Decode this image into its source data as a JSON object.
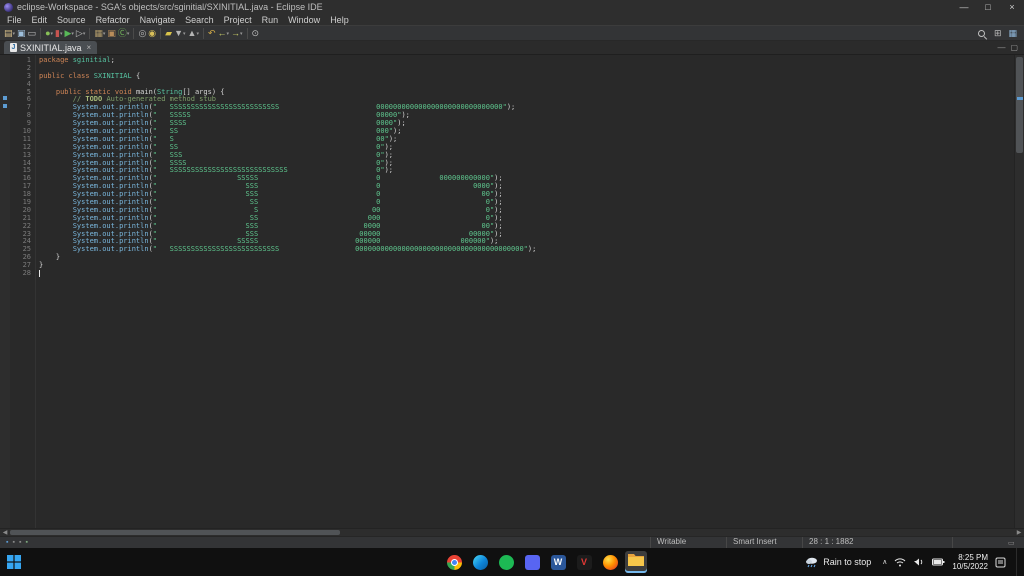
{
  "window": {
    "title": "eclipse-Workspace - SGA's objects/src/sginitial/SXINITIAL.java - Eclipse IDE",
    "controls": {
      "minimize": "—",
      "maximize": "□",
      "close": "×"
    }
  },
  "menubar": {
    "items": [
      "File",
      "Edit",
      "Source",
      "Refactor",
      "Navigate",
      "Search",
      "Project",
      "Run",
      "Window",
      "Help"
    ]
  },
  "toolbar": {
    "caret_glyph": "▾",
    "left": [
      {
        "name": "new-wizard",
        "glyph": "▤",
        "color": "#d8c08a",
        "caret": true
      },
      {
        "name": "save",
        "glyph": "▣",
        "color": "#9fc0dc"
      },
      {
        "name": "print",
        "glyph": "▭",
        "color": "#c0c0c0"
      },
      {
        "sep": true
      },
      {
        "name": "debug",
        "glyph": "●",
        "color": "#88c057",
        "caret": true
      },
      {
        "name": "coverage",
        "glyph": "▮",
        "color": "#c75450",
        "caret": true
      },
      {
        "name": "run",
        "glyph": "▶",
        "color": "#58b858",
        "caret": true
      },
      {
        "name": "external-tools",
        "glyph": "▷",
        "color": "#bdbdbd",
        "caret": true
      },
      {
        "sep": true
      },
      {
        "name": "new-java-project",
        "glyph": "▦",
        "color": "#b09a6a",
        "caret": true
      },
      {
        "name": "new-package",
        "glyph": "▣",
        "color": "#ba8d5a"
      },
      {
        "name": "new-class",
        "glyph": "Ⓒ",
        "color": "#74b85c",
        "caret": true
      },
      {
        "sep": true
      },
      {
        "name": "open-type",
        "glyph": "◎",
        "color": "#b8b8b8"
      },
      {
        "name": "search",
        "glyph": "◉",
        "color": "#d9c05a"
      },
      {
        "sep": true
      },
      {
        "name": "mark-occurrences",
        "glyph": "▰",
        "color": "#d9c34a"
      },
      {
        "name": "next-annotation",
        "glyph": "▼",
        "color": "#b5b5b5",
        "caret": true
      },
      {
        "name": "previous-annotation",
        "glyph": "▲",
        "color": "#b5b5b5",
        "caret": true
      },
      {
        "sep": true
      },
      {
        "name": "last-edit-location",
        "glyph": "↶",
        "color": "#d0a948"
      },
      {
        "name": "back",
        "glyph": "←",
        "color": "#cdd06a",
        "caret": true
      },
      {
        "name": "forward",
        "glyph": "→",
        "color": "#cdd06a",
        "caret": true
      },
      {
        "sep": true
      },
      {
        "name": "pin-editor",
        "glyph": "⊙",
        "color": "#bdbdbd"
      }
    ],
    "right": [
      {
        "name": "quick-search",
        "kind": "magnifier"
      },
      {
        "name": "open-perspective",
        "glyph": "⊞",
        "color": "#b8b8b8"
      },
      {
        "name": "java-perspective",
        "glyph": "▦",
        "color": "#8fb6d9"
      }
    ]
  },
  "tabbar": {
    "tabs": [
      {
        "label": "SXINITIAL.java",
        "close_glyph": "×",
        "file_icon": "J",
        "active": true
      }
    ],
    "minimize_glyph": "—",
    "maximize_glyph": "▢"
  },
  "editor": {
    "scroll_left_glyph": "◀",
    "scroll_right_glyph": "▶",
    "lines": [
      {
        "n": 1,
        "segs": [
          [
            "kw",
            "package "
          ],
          [
            "type",
            "sginitial"
          ],
          [
            "plain",
            ";"
          ]
        ]
      },
      {
        "n": 2,
        "segs": []
      },
      {
        "n": 3,
        "segs": [
          [
            "kw",
            "public class "
          ],
          [
            "type",
            "SXINITIAL"
          ],
          [
            "plain",
            " {"
          ]
        ]
      },
      {
        "n": 4,
        "segs": []
      },
      {
        "n": 5,
        "segs": [
          [
            "plain",
            "    "
          ],
          [
            "kw",
            "public static void "
          ],
          [
            "plain",
            "main("
          ],
          [
            "type",
            "String"
          ],
          [
            "plain",
            "[] args) {"
          ]
        ]
      },
      {
        "n": 6,
        "segs": [
          [
            "plain",
            "        "
          ],
          [
            "comment",
            "// "
          ],
          [
            "todo",
            "TODO"
          ],
          [
            "comment",
            " Auto-generated method stub"
          ]
        ]
      },
      {
        "n": 7,
        "segs": [
          [
            "plain",
            "        "
          ],
          [
            "sys",
            "System.out.println"
          ],
          [
            "plain",
            "("
          ],
          [
            "str",
            "\"   SSSSSSSSSSSSSSSSSSSSSSSSSS                       000000000000000000000000000000\""
          ],
          [
            "plain",
            ");"
          ]
        ]
      },
      {
        "n": 8,
        "segs": [
          [
            "plain",
            "        "
          ],
          [
            "sys",
            "System.out.println"
          ],
          [
            "plain",
            "("
          ],
          [
            "str",
            "\"   SSSSS                                            00000\""
          ],
          [
            "plain",
            ");"
          ]
        ]
      },
      {
        "n": 9,
        "segs": [
          [
            "plain",
            "        "
          ],
          [
            "sys",
            "System.out.println"
          ],
          [
            "plain",
            "("
          ],
          [
            "str",
            "\"   SSSS                                             0000\""
          ],
          [
            "plain",
            ");"
          ]
        ]
      },
      {
        "n": 10,
        "segs": [
          [
            "plain",
            "        "
          ],
          [
            "sys",
            "System.out.println"
          ],
          [
            "plain",
            "("
          ],
          [
            "str",
            "\"   SS                                               000\""
          ],
          [
            "plain",
            ");"
          ]
        ]
      },
      {
        "n": 11,
        "segs": [
          [
            "plain",
            "        "
          ],
          [
            "sys",
            "System.out.println"
          ],
          [
            "plain",
            "("
          ],
          [
            "str",
            "\"   S                                                00\""
          ],
          [
            "plain",
            ");"
          ]
        ]
      },
      {
        "n": 12,
        "segs": [
          [
            "plain",
            "        "
          ],
          [
            "sys",
            "System.out.println"
          ],
          [
            "plain",
            "("
          ],
          [
            "str",
            "\"   SS                                               0\""
          ],
          [
            "plain",
            ");"
          ]
        ]
      },
      {
        "n": 13,
        "segs": [
          [
            "plain",
            "        "
          ],
          [
            "sys",
            "System.out.println"
          ],
          [
            "plain",
            "("
          ],
          [
            "str",
            "\"   SSS                                              0\""
          ],
          [
            "plain",
            ");"
          ]
        ]
      },
      {
        "n": 14,
        "segs": [
          [
            "plain",
            "        "
          ],
          [
            "sys",
            "System.out.println"
          ],
          [
            "plain",
            "("
          ],
          [
            "str",
            "\"   SSSS                                             0\""
          ],
          [
            "plain",
            ");"
          ]
        ]
      },
      {
        "n": 15,
        "segs": [
          [
            "plain",
            "        "
          ],
          [
            "sys",
            "System.out.println"
          ],
          [
            "plain",
            "("
          ],
          [
            "str",
            "\"   SSSSSSSSSSSSSSSSSSSSSSSSSSSS                     0\""
          ],
          [
            "plain",
            ");"
          ]
        ]
      },
      {
        "n": 16,
        "segs": [
          [
            "plain",
            "        "
          ],
          [
            "sys",
            "System.out.println"
          ],
          [
            "plain",
            "("
          ],
          [
            "str",
            "\"                   SSSSS                            0              000000000000\""
          ],
          [
            "plain",
            ");"
          ]
        ]
      },
      {
        "n": 17,
        "segs": [
          [
            "plain",
            "        "
          ],
          [
            "sys",
            "System.out.println"
          ],
          [
            "plain",
            "("
          ],
          [
            "str",
            "\"                     SSS                            0                      0000\""
          ],
          [
            "plain",
            ");"
          ]
        ]
      },
      {
        "n": 18,
        "segs": [
          [
            "plain",
            "        "
          ],
          [
            "sys",
            "System.out.println"
          ],
          [
            "plain",
            "("
          ],
          [
            "str",
            "\"                     SSS                            0                        00\""
          ],
          [
            "plain",
            ");"
          ]
        ]
      },
      {
        "n": 19,
        "segs": [
          [
            "plain",
            "        "
          ],
          [
            "sys",
            "System.out.println"
          ],
          [
            "plain",
            "("
          ],
          [
            "str",
            "\"                      SS                            0                         0\""
          ],
          [
            "plain",
            ");"
          ]
        ]
      },
      {
        "n": 20,
        "segs": [
          [
            "plain",
            "        "
          ],
          [
            "sys",
            "System.out.println"
          ],
          [
            "plain",
            "("
          ],
          [
            "str",
            "\"                       S                           00                         0\""
          ],
          [
            "plain",
            ");"
          ]
        ]
      },
      {
        "n": 21,
        "segs": [
          [
            "plain",
            "        "
          ],
          [
            "sys",
            "System.out.println"
          ],
          [
            "plain",
            "("
          ],
          [
            "str",
            "\"                      SS                          000                         0\""
          ],
          [
            "plain",
            ");"
          ]
        ]
      },
      {
        "n": 22,
        "segs": [
          [
            "plain",
            "        "
          ],
          [
            "sys",
            "System.out.println"
          ],
          [
            "plain",
            "("
          ],
          [
            "str",
            "\"                     SSS                         0000                        00\""
          ],
          [
            "plain",
            ");"
          ]
        ]
      },
      {
        "n": 23,
        "segs": [
          [
            "plain",
            "        "
          ],
          [
            "sys",
            "System.out.println"
          ],
          [
            "plain",
            "("
          ],
          [
            "str",
            "\"                     SSS                        00000                     00000\""
          ],
          [
            "plain",
            ");"
          ]
        ]
      },
      {
        "n": 24,
        "segs": [
          [
            "plain",
            "        "
          ],
          [
            "sys",
            "System.out.println"
          ],
          [
            "plain",
            "("
          ],
          [
            "str",
            "\"                   SSSSS                       000000                   000000\""
          ],
          [
            "plain",
            ");"
          ]
        ]
      },
      {
        "n": 25,
        "segs": [
          [
            "plain",
            "        "
          ],
          [
            "sys",
            "System.out.println"
          ],
          [
            "plain",
            "("
          ],
          [
            "str",
            "\"   SSSSSSSSSSSSSSSSSSSSSSSSSS                  0000000000000000000000000000000000000000\""
          ],
          [
            "plain",
            ");"
          ]
        ]
      },
      {
        "n": 26,
        "segs": [
          [
            "plain",
            "    }"
          ]
        ]
      },
      {
        "n": 27,
        "segs": [
          [
            "plain",
            "}"
          ]
        ]
      },
      {
        "n": 28,
        "segs": [],
        "caret": true
      }
    ]
  },
  "statusbar": {
    "writable": "Writable",
    "insert_mode": "Smart Insert",
    "position": "28 : 1 : 1882",
    "progress_glyph": "▭",
    "icons": [
      {
        "name": "workspace-status-icon",
        "glyph": "▪",
        "color": "#5a9bd4"
      },
      {
        "name": "git-status-icon",
        "glyph": "▪",
        "color": "#8a8a8a"
      },
      {
        "name": "console-status-icon",
        "glyph": "▪",
        "color": "#8a8a8a"
      },
      {
        "name": "build-status-icon",
        "glyph": "▪",
        "color": "#7da87d"
      }
    ]
  },
  "taskbar": {
    "weather_label": "Rain to stop",
    "chevron_glyph": "∧",
    "time": "8:25 PM",
    "date": "10/5/2022",
    "apps": [
      {
        "name": "chrome",
        "kind": "chrome"
      },
      {
        "name": "edge",
        "kind": "edge"
      },
      {
        "name": "spotify",
        "kind": "circle",
        "color": "#1db954"
      },
      {
        "name": "discord",
        "kind": "square",
        "color": "#5865f2"
      },
      {
        "name": "word",
        "kind": "square",
        "color": "#2b579a",
        "letter": "W"
      },
      {
        "name": "vlc",
        "kind": "square",
        "color": "#1c1c1c",
        "letter": "V",
        "letter_color": "#e53935"
      },
      {
        "name": "firefox",
        "kind": "firefox"
      },
      {
        "name": "file-explorer",
        "kind": "folder",
        "active": true
      }
    ]
  }
}
